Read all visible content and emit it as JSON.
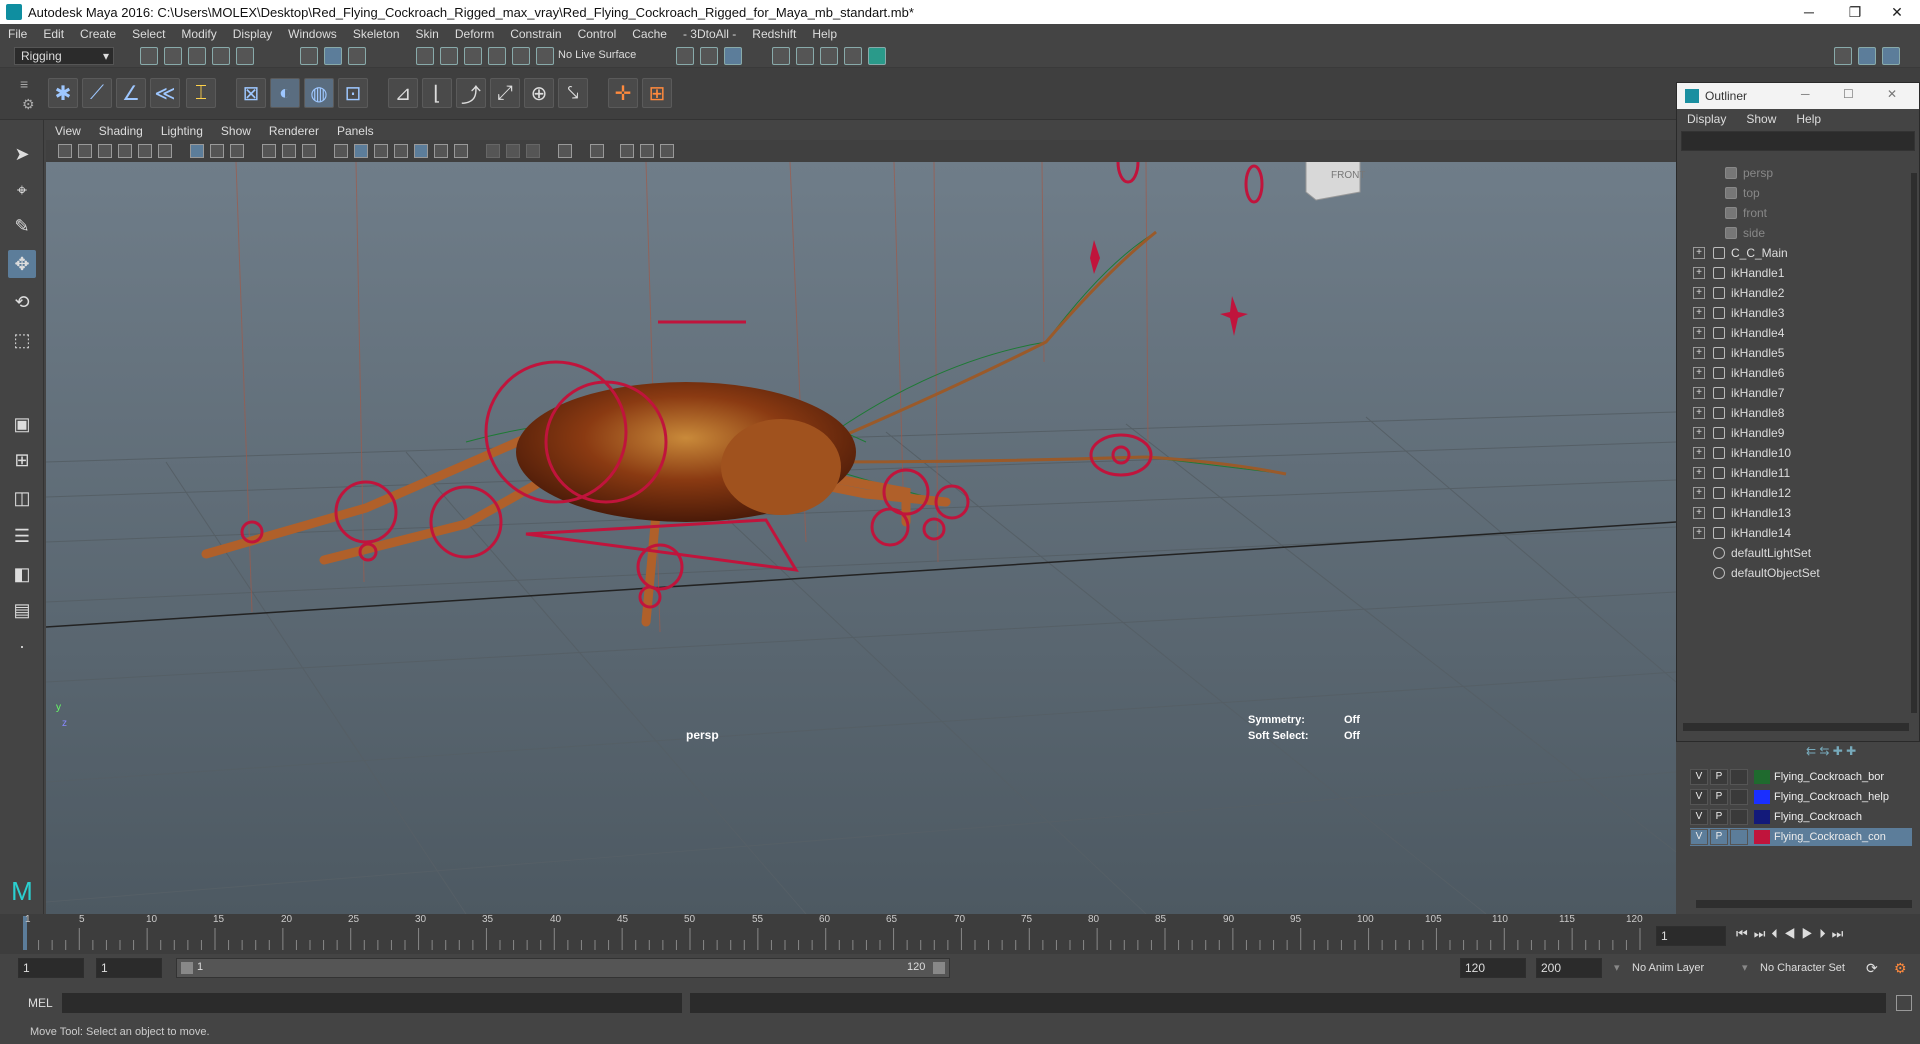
{
  "titlebar": {
    "title": "Autodesk Maya 2016: C:\\Users\\MOLEX\\Desktop\\Red_Flying_Cockroach_Rigged_max_vray\\Red_Flying_Cockroach_Rigged_for_Maya_mb_standart.mb*",
    "minimize": "─",
    "maximize": "❐",
    "close": "✕"
  },
  "menubar": [
    "File",
    "Edit",
    "Create",
    "Select",
    "Modify",
    "Display",
    "Windows",
    "Skeleton",
    "Skin",
    "Deform",
    "Constrain",
    "Control",
    "Cache",
    "- 3DtoAll -",
    "Redshift",
    "Help"
  ],
  "statusline": {
    "menuset": "Rigging",
    "live_surface": "No Live Surface"
  },
  "viewport": {
    "menus": [
      "View",
      "Shading",
      "Lighting",
      "Show",
      "Renderer",
      "Panels"
    ],
    "camera_label": "persp",
    "viewcube_label": "FRONT",
    "symmetry_label": "Symmetry:",
    "symmetry_value": "Off",
    "soft_select_label": "Soft Select:",
    "soft_select_value": "Off",
    "axis_y": "y",
    "axis_z": "z"
  },
  "outliner": {
    "title": "Outliner",
    "menus": [
      "Display",
      "Show",
      "Help"
    ],
    "cameras": [
      "persp",
      "top",
      "front",
      "side"
    ],
    "items": [
      "C_C_Main",
      "ikHandle1",
      "ikHandle2",
      "ikHandle3",
      "ikHandle4",
      "ikHandle5",
      "ikHandle6",
      "ikHandle7",
      "ikHandle8",
      "ikHandle9",
      "ikHandle10",
      "ikHandle11",
      "ikHandle12",
      "ikHandle13",
      "ikHandle14"
    ],
    "sets": [
      "defaultLightSet",
      "defaultObjectSet"
    ]
  },
  "layers": [
    {
      "v": "V",
      "p": "P",
      "color": "#1f6a2e",
      "name": "Flying_Cockroach_bor"
    },
    {
      "v": "V",
      "p": "P",
      "color": "#1a2fff",
      "name": "Flying_Cockroach_help"
    },
    {
      "v": "V",
      "p": "P",
      "color": "#131a7a",
      "name": "Flying_Cockroach"
    },
    {
      "v": "V",
      "p": "P",
      "color": "#c0143c",
      "name": "Flying_Cockroach_con"
    }
  ],
  "timeline": {
    "ticks": [
      "1",
      "5",
      "10",
      "15",
      "20",
      "25",
      "30",
      "35",
      "40",
      "45",
      "50",
      "55",
      "60",
      "65",
      "70",
      "75",
      "80",
      "85",
      "90",
      "95",
      "100",
      "105",
      "110",
      "115",
      "120"
    ],
    "current_frame": "1"
  },
  "range": {
    "start": "1",
    "playback_start": "1",
    "slider_start": "1",
    "slider_end": "120",
    "playback_end": "120",
    "end": "200",
    "anim_layer": "No Anim Layer",
    "character_set": "No Character Set"
  },
  "cmdline": {
    "label": "MEL"
  },
  "helpline": {
    "text": "Move Tool: Select an object to move."
  }
}
